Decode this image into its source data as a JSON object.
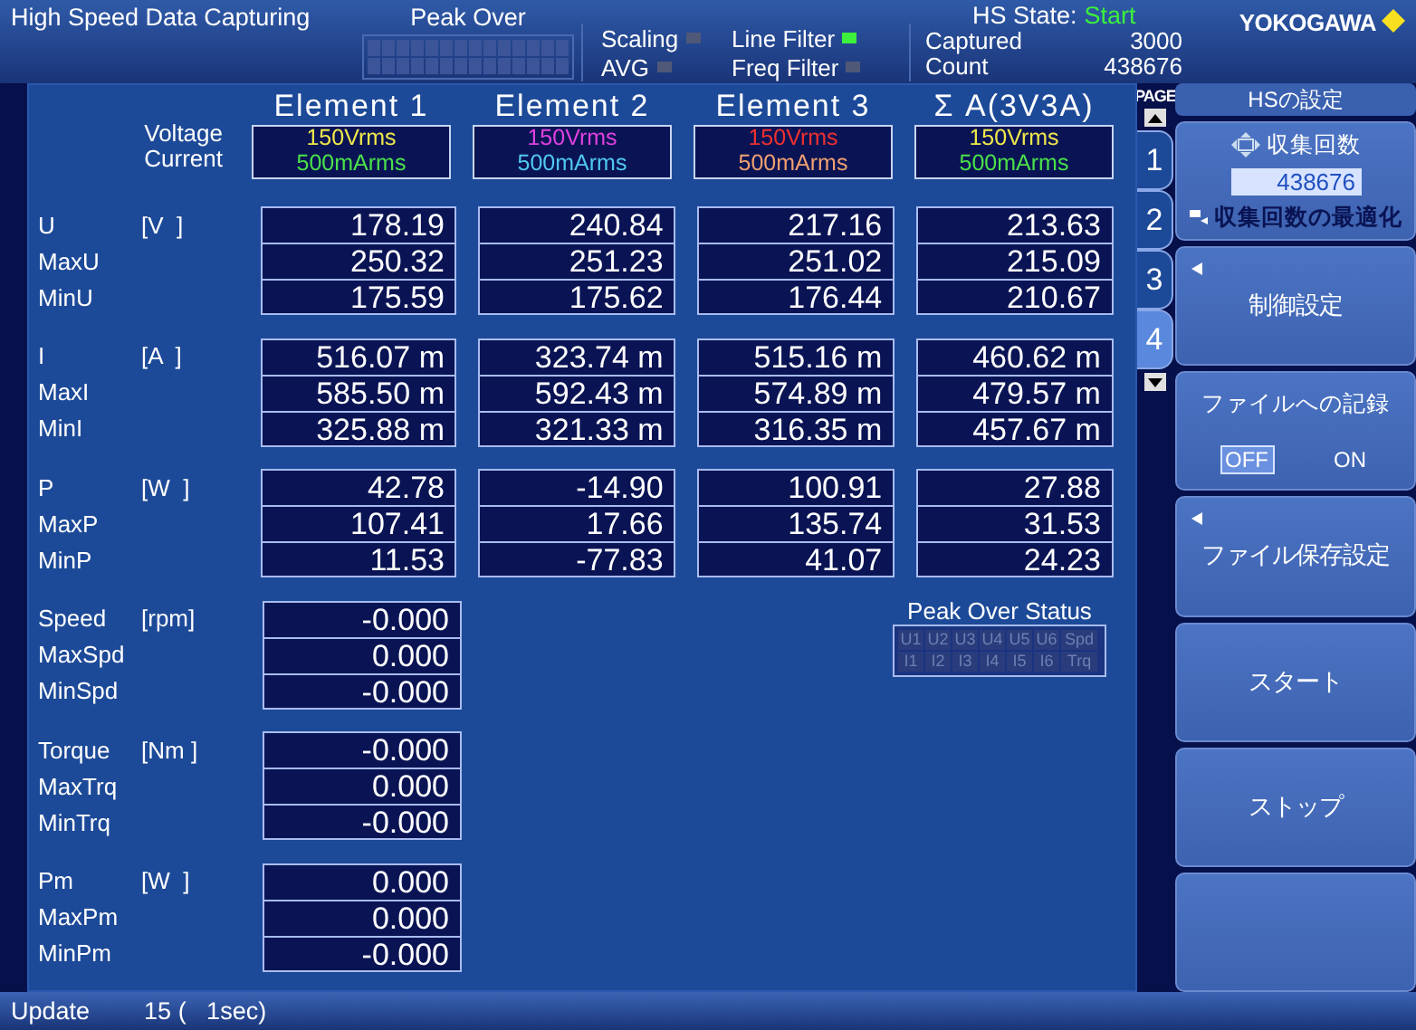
{
  "header": {
    "title": "High Speed Data Capturing",
    "peak_over": {
      "label": "Peak Over"
    },
    "indicators": [
      {
        "label": "Scaling",
        "on": false
      },
      {
        "label": "AVG",
        "on": false
      },
      {
        "label": "Line Filter",
        "on": true
      },
      {
        "label": "Freq Filter",
        "on": false
      }
    ],
    "hs_state": {
      "label": "HS State:",
      "value": "Start"
    },
    "counters": [
      {
        "label": "Captured",
        "value": "3000"
      },
      {
        "label": "Count",
        "value": "438676"
      }
    ],
    "logo": "YOKOGAWA"
  },
  "range_labels": [
    "Voltage",
    "Current"
  ],
  "elements": [
    {
      "title": "Element 1",
      "ranges": [
        {
          "label": "150Vrms",
          "color": "#f0e84a"
        },
        {
          "label": "500mArms",
          "color": "#4ae04a"
        }
      ]
    },
    {
      "title": "Element 2",
      "ranges": [
        {
          "label": "150Vrms",
          "color": "#e040e0"
        },
        {
          "label": "500mArms",
          "color": "#50c8f0"
        }
      ]
    },
    {
      "title": "Element 3",
      "ranges": [
        {
          "label": "150Vrms",
          "color": "#f03030"
        },
        {
          "label": "500mArms",
          "color": "#f0a070"
        }
      ]
    },
    {
      "title": "Σ A(3V3A)",
      "ranges": [
        {
          "label": "150Vrms",
          "color": "#f0e84a"
        },
        {
          "label": "500mArms",
          "color": "#4ae04a"
        }
      ]
    }
  ],
  "groups": [
    {
      "unit": "[V  ]",
      "rows": [
        {
          "name": "U",
          "values": [
            "178.19",
            "240.84",
            "217.16",
            "213.63"
          ]
        },
        {
          "name": "MaxU",
          "values": [
            "250.32",
            "251.23",
            "251.02",
            "215.09"
          ]
        },
        {
          "name": "MinU",
          "values": [
            "175.59",
            "175.62",
            "176.44",
            "210.67"
          ]
        }
      ]
    },
    {
      "unit": "[A  ]",
      "rows": [
        {
          "name": "I",
          "values": [
            "516.07 m",
            "323.74 m",
            "515.16 m",
            "460.62 m"
          ]
        },
        {
          "name": "MaxI",
          "values": [
            "585.50 m",
            "592.43 m",
            "574.89 m",
            "479.57 m"
          ]
        },
        {
          "name": "MinI",
          "values": [
            "325.88 m",
            "321.33 m",
            "316.35 m",
            "457.67 m"
          ]
        }
      ]
    },
    {
      "unit": "[W  ]",
      "rows": [
        {
          "name": "P",
          "values": [
            "42.78",
            "-14.90",
            "100.91",
            "27.88"
          ]
        },
        {
          "name": "MaxP",
          "values": [
            "107.41",
            "17.66",
            "135.74",
            "31.53"
          ]
        },
        {
          "name": "MinP",
          "values": [
            "11.53",
            "-77.83",
            "41.07",
            "24.23"
          ]
        }
      ]
    }
  ],
  "motor_groups": [
    {
      "unit": "[rpm]",
      "rows": [
        {
          "name": "Speed",
          "values": [
            "-0.000"
          ]
        },
        {
          "name": "MaxSpd",
          "values": [
            "0.000"
          ]
        },
        {
          "name": "MinSpd",
          "values": [
            "-0.000"
          ]
        }
      ]
    },
    {
      "unit": "[Nm ]",
      "rows": [
        {
          "name": "Torque",
          "values": [
            "-0.000"
          ]
        },
        {
          "name": "MaxTrq",
          "values": [
            "0.000"
          ]
        },
        {
          "name": "MinTrq",
          "values": [
            "-0.000"
          ]
        }
      ]
    },
    {
      "unit": "[W  ]",
      "rows": [
        {
          "name": "Pm",
          "values": [
            "0.000"
          ]
        },
        {
          "name": "MaxPm",
          "values": [
            "0.000"
          ]
        },
        {
          "name": "MinPm",
          "values": [
            "-0.000"
          ]
        }
      ]
    }
  ],
  "peak_over_status": {
    "title": "Peak Over Status",
    "rows": [
      [
        "U1",
        "U2",
        "U3",
        "U4",
        "U5",
        "U6",
        "Spd"
      ],
      [
        "I1",
        "I2",
        "I3",
        "I4",
        "I5",
        "I6",
        "Trq"
      ]
    ]
  },
  "page_tabs": {
    "label": "PAGE",
    "tabs": [
      {
        "label": "1",
        "selected": false
      },
      {
        "label": "2",
        "selected": false
      },
      {
        "label": "3",
        "selected": false
      },
      {
        "label": "4",
        "selected": true
      }
    ]
  },
  "softkeys": {
    "title": "HSの設定",
    "keys": [
      {
        "kind": "input",
        "label": "収集回数",
        "value": "438676",
        "sublabel": "収集回数の最適化"
      },
      {
        "kind": "submenu",
        "label": "制御設定"
      },
      {
        "kind": "toggle",
        "label": "ファイルへの記録",
        "options": [
          {
            "label": "OFF",
            "selected": true
          },
          {
            "label": "ON",
            "selected": false
          }
        ]
      },
      {
        "kind": "submenu",
        "label": "ファイル保存設定"
      },
      {
        "kind": "action",
        "label": "スタート"
      },
      {
        "kind": "action",
        "label": "ストップ"
      },
      {
        "kind": "empty"
      }
    ]
  },
  "status_bar": {
    "label": "Update",
    "value": "15 (   1sec)"
  }
}
